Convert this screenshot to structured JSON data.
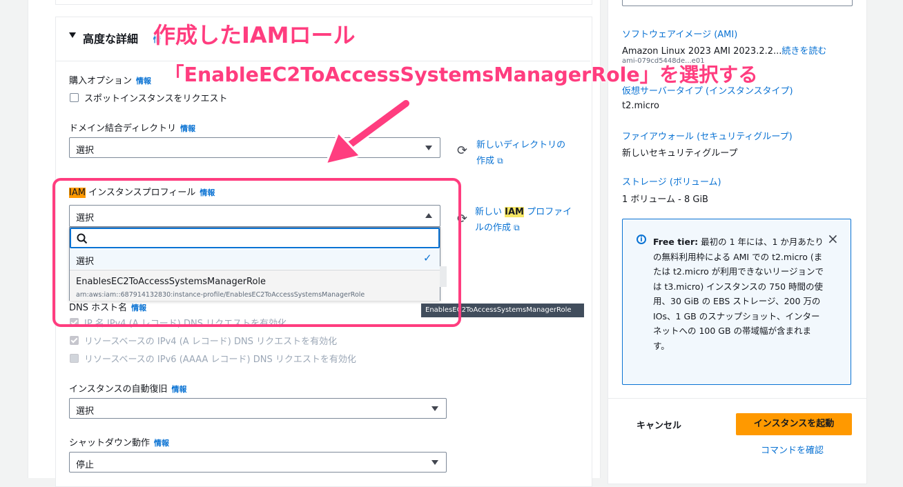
{
  "left": {
    "advanced_title": "高度な詳細",
    "advanced_info": "情",
    "purchase_option_label": "購入オプション",
    "info": "情報",
    "spot_checkbox_label": "スポットインスタンスをリクエスト",
    "domain_dir_label": "ドメイン結合ディレクトリ",
    "domain_dir_value": "選択",
    "new_dir_link_line1": "新しいディレクトリの",
    "new_dir_link_line2": "作成",
    "iam_label_hl": "IAM",
    "iam_label_rest": "インスタンスプロフィール",
    "iam_select_value": "選択",
    "new_iam_link_pre": "新しい",
    "new_iam_link_hl": "IAM",
    "new_iam_link_post": "プロファイ",
    "new_iam_link_line2": "ルの作成",
    "dns_hostname_label": "DNS ホスト名",
    "dns_opt1": "IP 名 IPv4 (A レコード) DNS リクエストを有効化",
    "dns_opt2": "リソースベースの IPv4 (A レコード) DNS リクエストを有効化",
    "dns_opt3": "リソースベースの IPv6 (AAAA レコード) DNS リクエストを有効化",
    "auto_recovery_label": "インスタンスの自動復旧",
    "auto_recovery_value": "選択",
    "shutdown_label": "シャットダウン動作",
    "shutdown_value": "停止"
  },
  "dropdown": {
    "search_placeholder": "",
    "option_default": "選択",
    "option_role_name": "EnablesEC2ToAccessSystemsManagerRole",
    "option_role_arn": "arn:aws:iam::687914132830:instance-profile/EnablesEC2ToAccessSystemsManagerRole",
    "tooltip": "EnablesEC2ToAccessSystemsManagerRole"
  },
  "summary": {
    "ami_link": "ソフトウェアイメージ (AMI)",
    "ami_value": "Amazon Linux 2023 AMI 2023.2.2...",
    "ami_more": "続きを読む",
    "ami_id": "ami-079cd5448de...e01",
    "instance_type_link": "仮想サーバータイプ (インスタンスタイプ)",
    "instance_type_value": "t2.micro",
    "firewall_link": "ファイアウォール (セキュリティグループ)",
    "firewall_value": "新しいセキュリティグループ",
    "storage_link": "ストレージ (ボリューム)",
    "storage_value": "1 ボリューム - 8 GiB",
    "free_tier_title": "Free tier:",
    "free_tier_text": "最初の 1 年には、1 か月あたりの無料利用枠による AMI での t2.micro (または t2.micro が利用できないリージョンでは t3.micro) インスタンスの 750 時間の使用、30 GiB の EBS ストレージ、200 万の IOs、1 GB のスナップショット、インターネットへの 100 GB の帯域幅が含まれます。",
    "cancel": "キャンセル",
    "launch": "インスタンスを起動",
    "confirm_command": "コマンドを確認"
  },
  "annotation": {
    "line1": "作成したIAMロール",
    "line2": "「EnableEC2ToAccessSystemsManagerRole」を選択する",
    "color": "#ff3d7f"
  }
}
